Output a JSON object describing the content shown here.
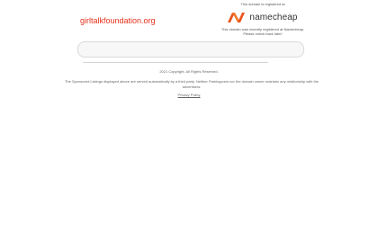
{
  "domain": {
    "name": "girltalkfoundation.org"
  },
  "registrar": {
    "top_text": "This domain is registered at",
    "logo_text": "namecheap",
    "note_line1": "This domain was recently registered at Namecheap.",
    "note_line2": "Please check back later!",
    "brand_color": "#e8531c"
  },
  "search": {
    "placeholder": ""
  },
  "footer": {
    "copyright": "2021 Copyright.  All Rights Reserved.",
    "disclaimer_line1": "The Sponsored Listings displayed above are served automatically by a third party. Neither Parkingcrew nor the domain owner maintain any relationship with the",
    "disclaimer_line2": "advertisers.",
    "privacy_label": "Privacy Policy"
  }
}
